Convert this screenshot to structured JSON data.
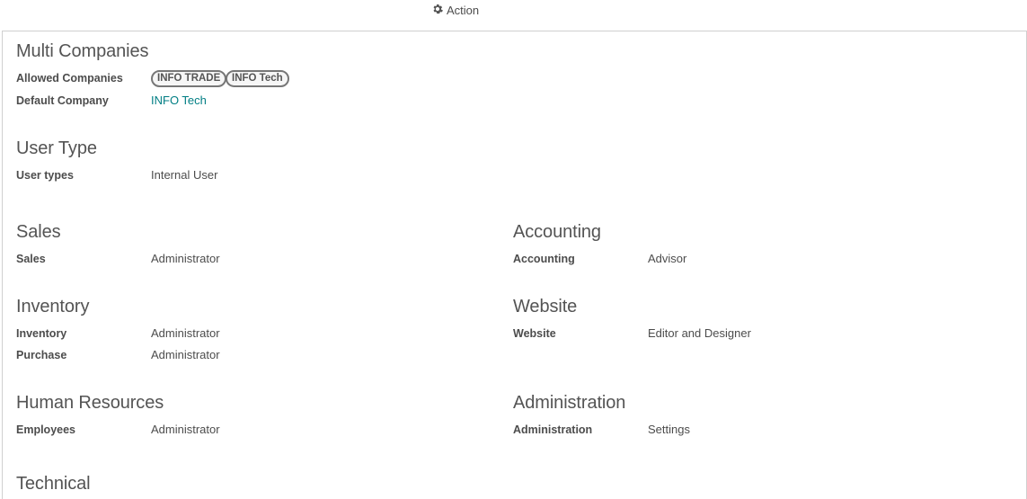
{
  "toolbar": {
    "action_label": "Action",
    "action_icon": "gear-icon"
  },
  "multi_companies": {
    "title": "Multi Companies",
    "allowed_label": "Allowed Companies",
    "allowed_tags": [
      "INFO TRADE",
      "INFO Tech"
    ],
    "default_label": "Default Company",
    "default_value": "INFO Tech"
  },
  "user_type": {
    "title": "User Type",
    "label": "User types",
    "value": "Internal User"
  },
  "sales": {
    "title": "Sales",
    "label": "Sales",
    "value": "Administrator"
  },
  "accounting": {
    "title": "Accounting",
    "label": "Accounting",
    "value": "Advisor"
  },
  "inventory": {
    "title": "Inventory",
    "inventory_label": "Inventory",
    "inventory_value": "Administrator",
    "purchase_label": "Purchase",
    "purchase_value": "Administrator"
  },
  "website": {
    "title": "Website",
    "label": "Website",
    "value": "Editor and Designer"
  },
  "human_resources": {
    "title": "Human Resources",
    "label": "Employees",
    "value": "Administrator"
  },
  "administration": {
    "title": "Administration",
    "label": "Administration",
    "value": "Settings"
  },
  "technical": {
    "title": "Technical"
  },
  "colors": {
    "link": "#017e84",
    "text": "#4c4c4c",
    "border": "#d0d0d0"
  }
}
